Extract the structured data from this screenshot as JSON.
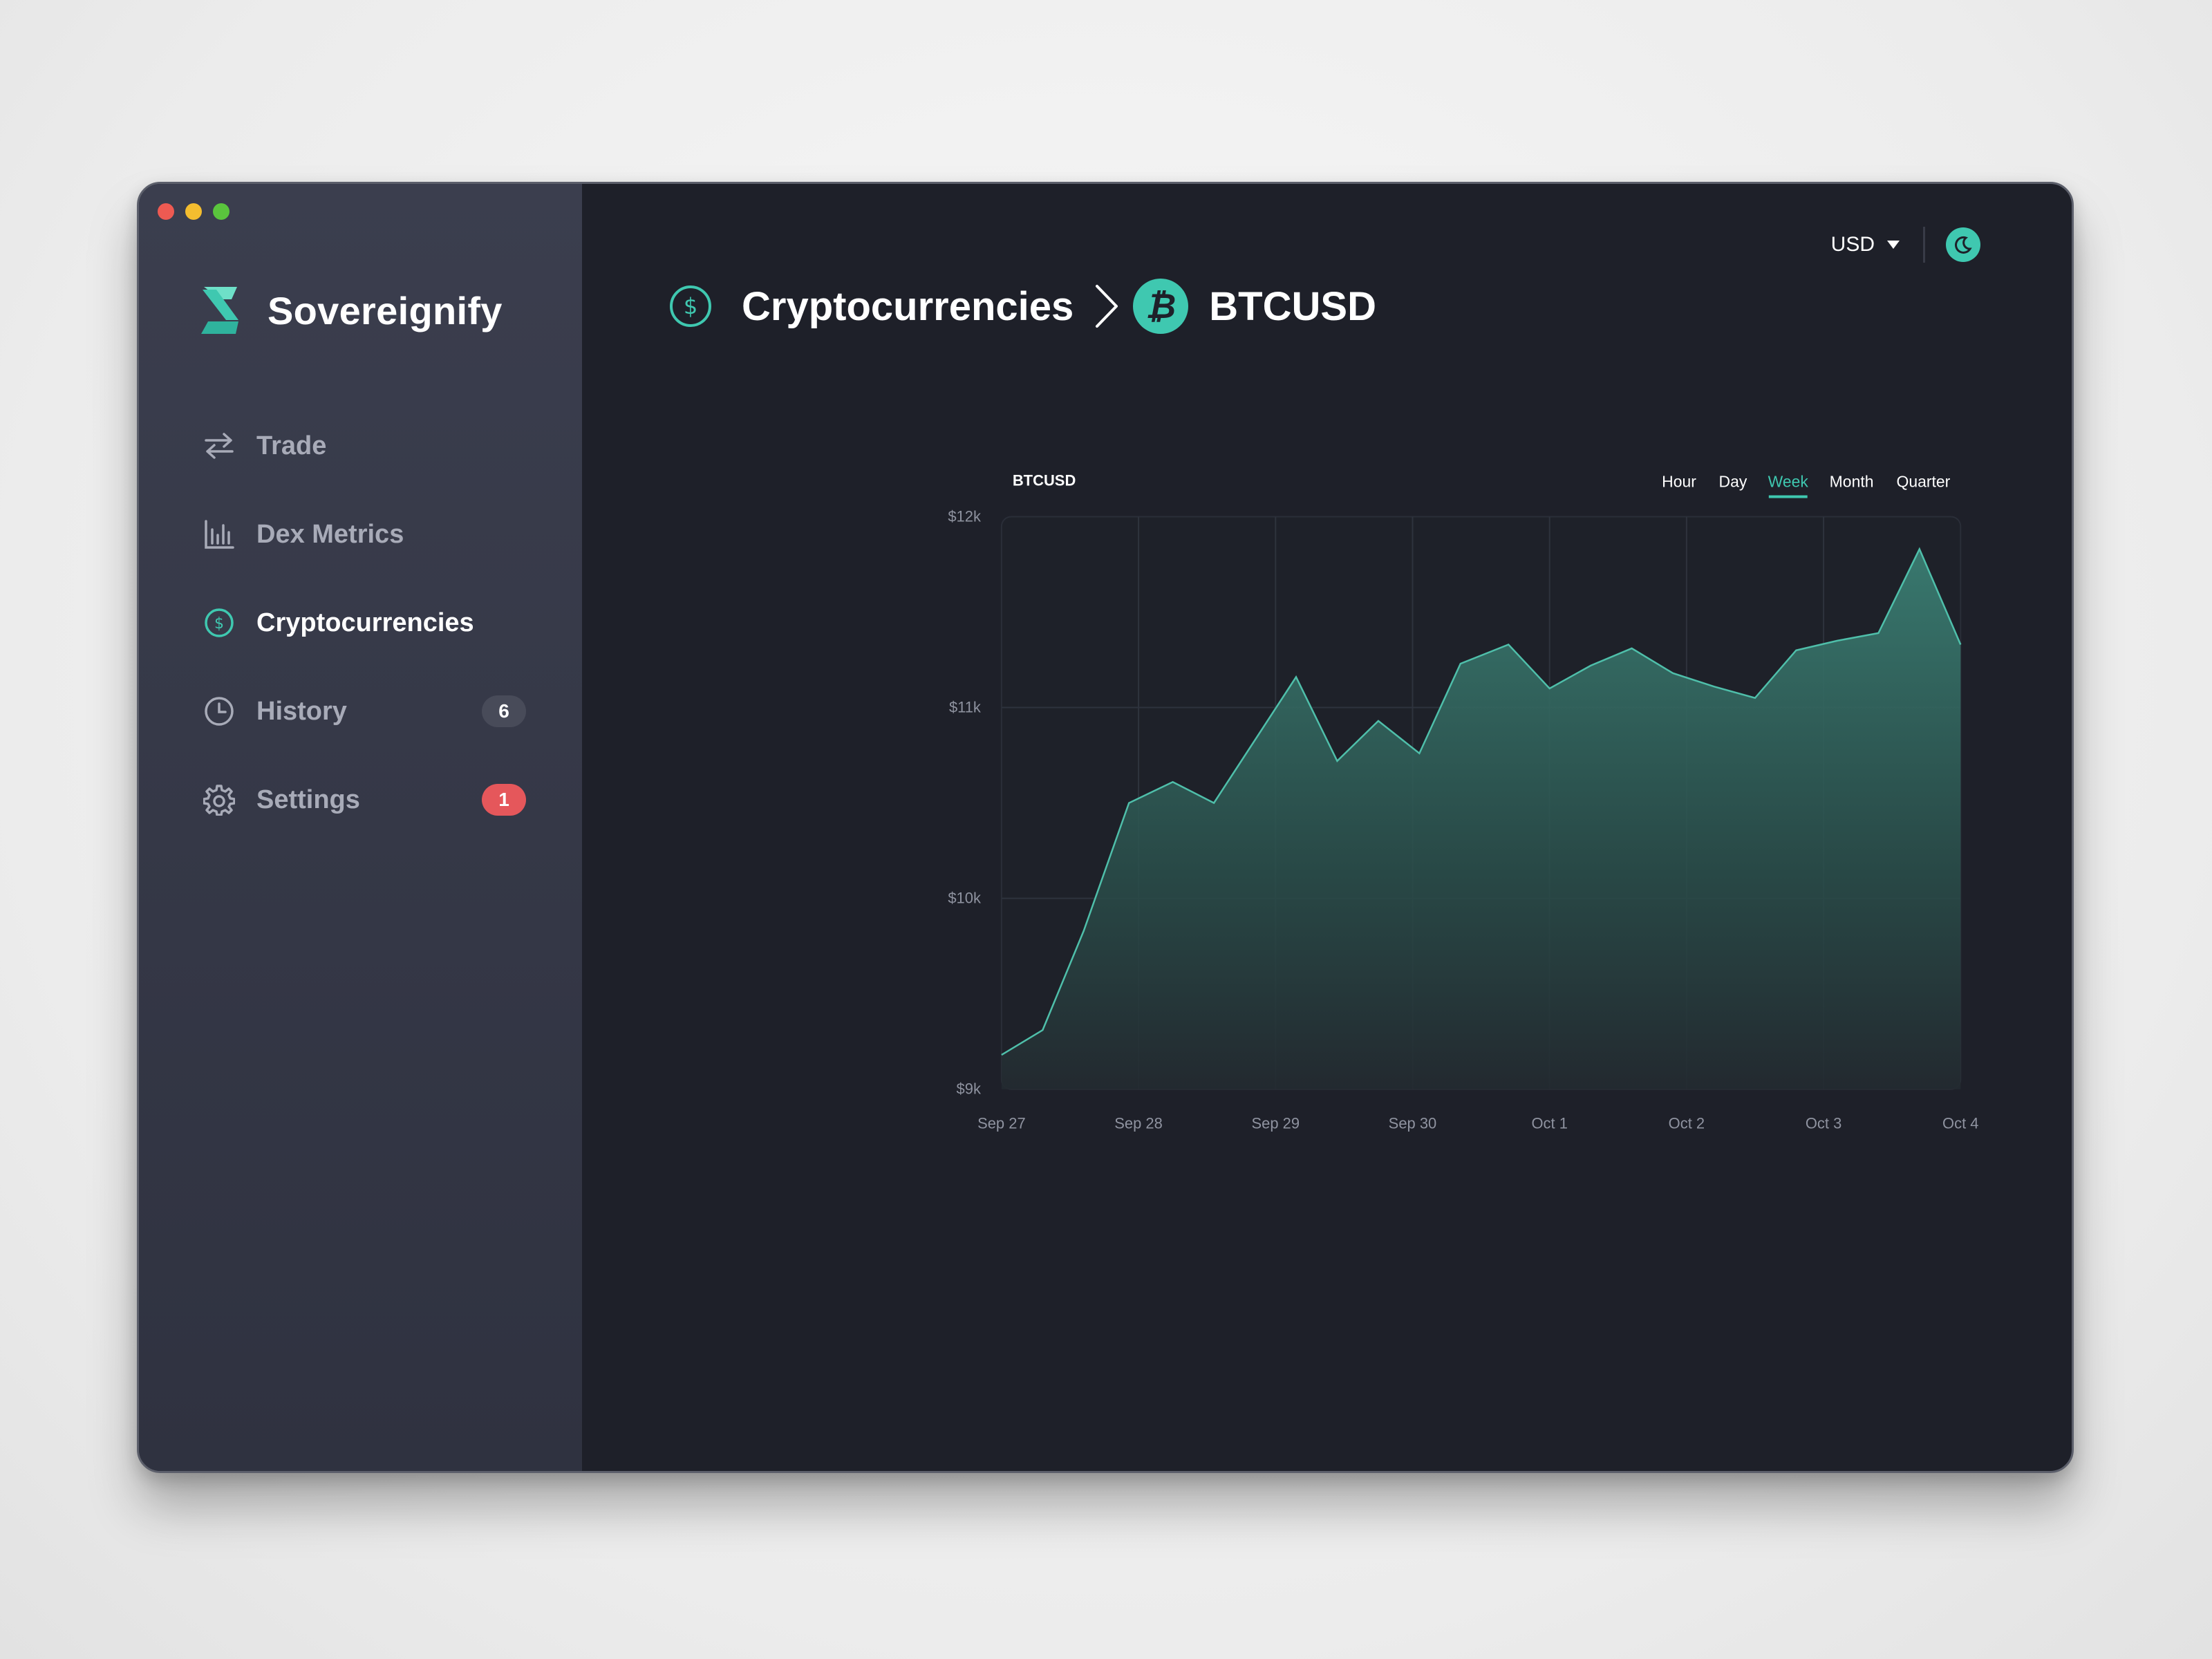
{
  "app": {
    "name": "Sovereignify"
  },
  "sidebar": {
    "items": [
      {
        "label": "Trade",
        "icon": "arrows-swap-icon",
        "active": false
      },
      {
        "label": "Dex Metrics",
        "icon": "bar-chart-icon",
        "active": false
      },
      {
        "label": "Cryptocurrencies",
        "icon": "dollar-circle-icon",
        "active": true
      },
      {
        "label": "History",
        "icon": "clock-icon",
        "active": false,
        "badge": "6"
      },
      {
        "label": "Settings",
        "icon": "gear-icon",
        "active": false,
        "badge": "1"
      }
    ]
  },
  "topbar": {
    "currency": "USD",
    "theme_icon": "moon-icon"
  },
  "breadcrumb": {
    "parent": "Cryptocurrencies",
    "current": "BTCUSD"
  },
  "chart": {
    "timeframes": [
      "Hour",
      "Day",
      "Week",
      "Month",
      "Quarter"
    ],
    "active_timeframe": "Week"
  },
  "colors": {
    "accent": "#3fc8b0",
    "badge_red": "#e5575b",
    "background": "#1e2029",
    "sidebar": "#343746"
  },
  "chart_data": {
    "type": "area",
    "title": "BTCUSD",
    "x_tick_labels": [
      "Sep 27",
      "Sep 28",
      "Sep 29",
      "Sep 30",
      "Oct 1",
      "Oct 2",
      "Oct 3",
      "Oct 4"
    ],
    "y_tick_labels": [
      "$12k",
      "$11k",
      "$10k",
      "$9k"
    ],
    "ylim": [
      9000,
      12000
    ],
    "xlim": [
      0,
      7
    ],
    "grid": true,
    "series": [
      {
        "x": [
          0,
          0.3,
          0.6,
          0.93,
          1.25,
          1.55,
          2.15,
          2.45,
          2.75,
          3.05,
          3.35,
          3.7,
          4.0,
          4.3,
          4.6,
          4.9,
          5.2,
          5.5,
          5.8,
          6.1,
          6.4,
          6.7,
          7.0
        ],
        "values": [
          9180,
          9310,
          9830,
          10500,
          10610,
          10500,
          11160,
          10720,
          10930,
          10760,
          11230,
          11330,
          11100,
          11220,
          11310,
          11180,
          11110,
          11050,
          11300,
          11350,
          11390,
          11830,
          11330
        ]
      }
    ]
  }
}
